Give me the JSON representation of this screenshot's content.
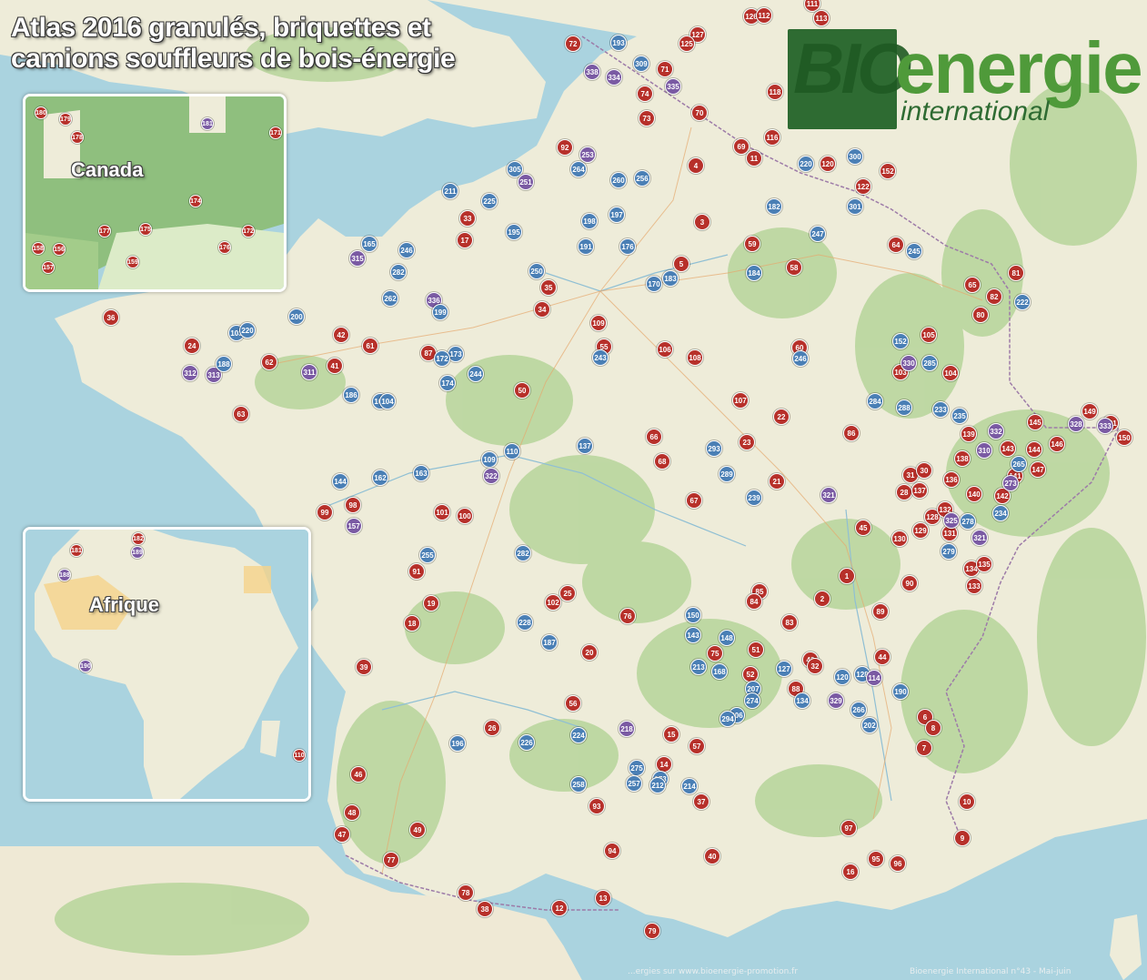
{
  "title": {
    "line1": "Atlas 2016 granulés, briquettes et",
    "line2": "camions souffleurs de bois-énergie"
  },
  "logo": {
    "bio": "BIO",
    "energie": "energie",
    "international": "international"
  },
  "insets": {
    "canada": {
      "label": "Canada"
    },
    "africa": {
      "label": "Afrique"
    }
  },
  "attribution": {
    "left": "...ergies sur www.bioenergie-promotion.fr",
    "right": "Bioenergie International n°43 - Mai-juin"
  },
  "colors": {
    "water": "#aad3df",
    "land": "#eeecd9",
    "forest": "#b6d59a",
    "granule_marker": "#b7302a",
    "truck_marker": "#4a7fb5",
    "briquette_marker": "#7a5aa3"
  },
  "markers": [
    {
      "label": "72",
      "type": "granule"
    },
    {
      "label": "126",
      "type": "granule"
    },
    {
      "label": "112",
      "type": "granule"
    },
    {
      "label": "111",
      "type": "granule"
    },
    {
      "label": "113",
      "type": "granule"
    },
    {
      "label": "127",
      "type": "granule"
    },
    {
      "label": "125",
      "type": "granule"
    },
    {
      "label": "71",
      "type": "granule"
    },
    {
      "label": "74",
      "type": "granule"
    },
    {
      "label": "73",
      "type": "granule"
    },
    {
      "label": "70",
      "type": "granule"
    },
    {
      "label": "118",
      "type": "granule"
    },
    {
      "label": "116",
      "type": "granule"
    },
    {
      "label": "69",
      "type": "granule"
    },
    {
      "label": "11",
      "type": "granule"
    },
    {
      "label": "120",
      "type": "granule"
    },
    {
      "label": "152",
      "type": "granule"
    },
    {
      "label": "122",
      "type": "granule"
    },
    {
      "label": "92",
      "type": "granule"
    },
    {
      "label": "4",
      "type": "granule"
    },
    {
      "label": "3",
      "type": "granule"
    },
    {
      "label": "33",
      "type": "granule"
    },
    {
      "label": "17",
      "type": "granule"
    },
    {
      "label": "59",
      "type": "granule"
    },
    {
      "label": "64",
      "type": "granule"
    },
    {
      "label": "81",
      "type": "granule"
    },
    {
      "label": "5",
      "type": "granule"
    },
    {
      "label": "58",
      "type": "granule"
    },
    {
      "label": "35",
      "type": "granule"
    },
    {
      "label": "34",
      "type": "granule"
    },
    {
      "label": "65",
      "type": "granule"
    },
    {
      "label": "82",
      "type": "granule"
    },
    {
      "label": "80",
      "type": "granule"
    },
    {
      "label": "36",
      "type": "granule"
    },
    {
      "label": "24",
      "type": "granule"
    },
    {
      "label": "42",
      "type": "granule"
    },
    {
      "label": "61",
      "type": "granule"
    },
    {
      "label": "62",
      "type": "granule"
    },
    {
      "label": "41",
      "type": "granule"
    },
    {
      "label": "87",
      "type": "granule"
    },
    {
      "label": "109",
      "type": "granule"
    },
    {
      "label": "55",
      "type": "granule"
    },
    {
      "label": "106",
      "type": "granule"
    },
    {
      "label": "108",
      "type": "granule"
    },
    {
      "label": "60",
      "type": "granule"
    },
    {
      "label": "105",
      "type": "granule"
    },
    {
      "label": "103",
      "type": "granule"
    },
    {
      "label": "104",
      "type": "granule"
    },
    {
      "label": "63",
      "type": "granule"
    },
    {
      "label": "50",
      "type": "granule"
    },
    {
      "label": "107",
      "type": "granule"
    },
    {
      "label": "22",
      "type": "granule"
    },
    {
      "label": "86",
      "type": "granule"
    },
    {
      "label": "139",
      "type": "granule"
    },
    {
      "label": "145",
      "type": "granule"
    },
    {
      "label": "149",
      "type": "granule"
    },
    {
      "label": "151",
      "type": "granule"
    },
    {
      "label": "150",
      "type": "granule"
    },
    {
      "label": "66",
      "type": "granule"
    },
    {
      "label": "68",
      "type": "granule"
    },
    {
      "label": "23",
      "type": "granule"
    },
    {
      "label": "143",
      "type": "granule"
    },
    {
      "label": "144",
      "type": "granule"
    },
    {
      "label": "146",
      "type": "granule"
    },
    {
      "label": "138",
      "type": "granule"
    },
    {
      "label": "147",
      "type": "granule"
    },
    {
      "label": "141",
      "type": "granule"
    },
    {
      "label": "21",
      "type": "granule"
    },
    {
      "label": "31",
      "type": "granule"
    },
    {
      "label": "30",
      "type": "granule"
    },
    {
      "label": "136",
      "type": "granule"
    },
    {
      "label": "28",
      "type": "granule"
    },
    {
      "label": "137",
      "type": "granule"
    },
    {
      "label": "140",
      "type": "granule"
    },
    {
      "label": "142",
      "type": "granule"
    },
    {
      "label": "99",
      "type": "granule"
    },
    {
      "label": "98",
      "type": "granule"
    },
    {
      "label": "101",
      "type": "granule"
    },
    {
      "label": "100",
      "type": "granule"
    },
    {
      "label": "67",
      "type": "granule"
    },
    {
      "label": "45",
      "type": "granule"
    },
    {
      "label": "128",
      "type": "granule"
    },
    {
      "label": "129",
      "type": "granule"
    },
    {
      "label": "131",
      "type": "granule"
    },
    {
      "label": "130",
      "type": "granule"
    },
    {
      "label": "132",
      "type": "granule"
    },
    {
      "label": "91",
      "type": "granule"
    },
    {
      "label": "19",
      "type": "granule"
    },
    {
      "label": "18",
      "type": "granule"
    },
    {
      "label": "25",
      "type": "granule"
    },
    {
      "label": "102",
      "type": "granule"
    },
    {
      "label": "76",
      "type": "granule"
    },
    {
      "label": "1",
      "type": "granule"
    },
    {
      "label": "2",
      "type": "granule"
    },
    {
      "label": "90",
      "type": "granule"
    },
    {
      "label": "134",
      "type": "granule"
    },
    {
      "label": "135",
      "type": "granule"
    },
    {
      "label": "133",
      "type": "granule"
    },
    {
      "label": "85",
      "type": "granule"
    },
    {
      "label": "84",
      "type": "granule"
    },
    {
      "label": "83",
      "type": "granule"
    },
    {
      "label": "89",
      "type": "granule"
    },
    {
      "label": "39",
      "type": "granule"
    },
    {
      "label": "20",
      "type": "granule"
    },
    {
      "label": "75",
      "type": "granule"
    },
    {
      "label": "51",
      "type": "granule"
    },
    {
      "label": "52",
      "type": "granule"
    },
    {
      "label": "43",
      "type": "granule"
    },
    {
      "label": "32",
      "type": "granule"
    },
    {
      "label": "44",
      "type": "granule"
    },
    {
      "label": "88",
      "type": "granule"
    },
    {
      "label": "56",
      "type": "granule"
    },
    {
      "label": "26",
      "type": "granule"
    },
    {
      "label": "15",
      "type": "granule"
    },
    {
      "label": "57",
      "type": "granule"
    },
    {
      "label": "6",
      "type": "granule"
    },
    {
      "label": "8",
      "type": "granule"
    },
    {
      "label": "7",
      "type": "granule"
    },
    {
      "label": "46",
      "type": "granule"
    },
    {
      "label": "14",
      "type": "granule"
    },
    {
      "label": "37",
      "type": "granule"
    },
    {
      "label": "10",
      "type": "granule"
    },
    {
      "label": "48",
      "type": "granule"
    },
    {
      "label": "47",
      "type": "granule"
    },
    {
      "label": "49",
      "type": "granule"
    },
    {
      "label": "93",
      "type": "granule"
    },
    {
      "label": "97",
      "type": "granule"
    },
    {
      "label": "9",
      "type": "granule"
    },
    {
      "label": "77",
      "type": "granule"
    },
    {
      "label": "94",
      "type": "granule"
    },
    {
      "label": "40",
      "type": "granule"
    },
    {
      "label": "95",
      "type": "granule"
    },
    {
      "label": "96",
      "type": "granule"
    },
    {
      "label": "16",
      "type": "granule"
    },
    {
      "label": "78",
      "type": "granule"
    },
    {
      "label": "38",
      "type": "granule"
    },
    {
      "label": "12",
      "type": "granule"
    },
    {
      "label": "13",
      "type": "granule"
    },
    {
      "label": "79",
      "type": "granule"
    },
    {
      "label": "193",
      "type": "truck"
    },
    {
      "label": "309",
      "type": "truck"
    },
    {
      "label": "334",
      "type": "briquette"
    },
    {
      "label": "335",
      "type": "briquette"
    },
    {
      "label": "338",
      "type": "briquette"
    },
    {
      "label": "220",
      "type": "truck"
    },
    {
      "label": "300",
      "type": "truck"
    },
    {
      "label": "301",
      "type": "truck"
    },
    {
      "label": "305",
      "type": "truck"
    },
    {
      "label": "264",
      "type": "truck"
    },
    {
      "label": "253",
      "type": "briquette"
    },
    {
      "label": "260",
      "type": "truck"
    },
    {
      "label": "256",
      "type": "truck"
    },
    {
      "label": "251",
      "type": "briquette"
    },
    {
      "label": "211",
      "type": "truck"
    },
    {
      "label": "225",
      "type": "truck"
    },
    {
      "label": "195",
      "type": "truck"
    },
    {
      "label": "198",
      "type": "truck"
    },
    {
      "label": "197",
      "type": "truck"
    },
    {
      "label": "191",
      "type": "truck"
    },
    {
      "label": "176",
      "type": "truck"
    },
    {
      "label": "182",
      "type": "truck"
    },
    {
      "label": "247",
      "type": "truck"
    },
    {
      "label": "245",
      "type": "truck"
    },
    {
      "label": "165",
      "type": "truck"
    },
    {
      "label": "246",
      "type": "truck"
    },
    {
      "label": "315",
      "type": "briquette"
    },
    {
      "label": "282",
      "type": "truck"
    },
    {
      "label": "262",
      "type": "truck"
    },
    {
      "label": "250",
      "type": "truck"
    },
    {
      "label": "170",
      "type": "truck"
    },
    {
      "label": "183",
      "type": "truck"
    },
    {
      "label": "184",
      "type": "truck"
    },
    {
      "label": "222",
      "type": "truck"
    },
    {
      "label": "336",
      "type": "briquette"
    },
    {
      "label": "199",
      "type": "truck"
    },
    {
      "label": "200",
      "type": "truck"
    },
    {
      "label": "103",
      "type": "truck"
    },
    {
      "label": "220",
      "type": "truck"
    },
    {
      "label": "312",
      "type": "briquette"
    },
    {
      "label": "313",
      "type": "briquette"
    },
    {
      "label": "188",
      "type": "truck"
    },
    {
      "label": "311",
      "type": "briquette"
    },
    {
      "label": "186",
      "type": "truck"
    },
    {
      "label": "105",
      "type": "truck"
    },
    {
      "label": "104",
      "type": "truck"
    },
    {
      "label": "173",
      "type": "truck"
    },
    {
      "label": "172",
      "type": "truck"
    },
    {
      "label": "174",
      "type": "truck"
    },
    {
      "label": "244",
      "type": "truck"
    },
    {
      "label": "243",
      "type": "truck"
    },
    {
      "label": "246",
      "type": "truck"
    },
    {
      "label": "152",
      "type": "truck"
    },
    {
      "label": "330",
      "type": "briquette"
    },
    {
      "label": "285",
      "type": "truck"
    },
    {
      "label": "284",
      "type": "truck"
    },
    {
      "label": "233",
      "type": "truck"
    },
    {
      "label": "288",
      "type": "truck"
    },
    {
      "label": "235",
      "type": "truck"
    },
    {
      "label": "332",
      "type": "briquette"
    },
    {
      "label": "328",
      "type": "briquette"
    },
    {
      "label": "333",
      "type": "briquette"
    },
    {
      "label": "162",
      "type": "truck"
    },
    {
      "label": "163",
      "type": "truck"
    },
    {
      "label": "144",
      "type": "truck"
    },
    {
      "label": "157",
      "type": "briquette"
    },
    {
      "label": "110",
      "type": "truck"
    },
    {
      "label": "109",
      "type": "truck"
    },
    {
      "label": "322",
      "type": "briquette"
    },
    {
      "label": "137",
      "type": "truck"
    },
    {
      "label": "293",
      "type": "truck"
    },
    {
      "label": "289",
      "type": "truck"
    },
    {
      "label": "239",
      "type": "truck"
    },
    {
      "label": "321",
      "type": "briquette"
    },
    {
      "label": "325",
      "type": "briquette"
    },
    {
      "label": "279",
      "type": "truck"
    },
    {
      "label": "278",
      "type": "truck"
    },
    {
      "label": "321",
      "type": "briquette"
    },
    {
      "label": "265",
      "type": "truck"
    },
    {
      "label": "310",
      "type": "briquette"
    },
    {
      "label": "273",
      "type": "briquette"
    },
    {
      "label": "234",
      "type": "truck"
    },
    {
      "label": "255",
      "type": "truck"
    },
    {
      "label": "282",
      "type": "truck"
    },
    {
      "label": "228",
      "type": "truck"
    },
    {
      "label": "187",
      "type": "truck"
    },
    {
      "label": "150",
      "type": "truck"
    },
    {
      "label": "143",
      "type": "truck"
    },
    {
      "label": "148",
      "type": "truck"
    },
    {
      "label": "168",
      "type": "truck"
    },
    {
      "label": "127",
      "type": "truck"
    },
    {
      "label": "120",
      "type": "truck"
    },
    {
      "label": "128",
      "type": "truck"
    },
    {
      "label": "114",
      "type": "briquette"
    },
    {
      "label": "190",
      "type": "truck"
    },
    {
      "label": "202",
      "type": "truck"
    },
    {
      "label": "266",
      "type": "truck"
    },
    {
      "label": "329",
      "type": "briquette"
    },
    {
      "label": "134",
      "type": "truck"
    },
    {
      "label": "213",
      "type": "truck"
    },
    {
      "label": "207",
      "type": "truck"
    },
    {
      "label": "206",
      "type": "truck"
    },
    {
      "label": "196",
      "type": "truck"
    },
    {
      "label": "226",
      "type": "truck"
    },
    {
      "label": "224",
      "type": "truck"
    },
    {
      "label": "218",
      "type": "briquette"
    },
    {
      "label": "294",
      "type": "truck"
    },
    {
      "label": "274",
      "type": "truck"
    },
    {
      "label": "275",
      "type": "truck"
    },
    {
      "label": "273",
      "type": "truck"
    },
    {
      "label": "212",
      "type": "truck"
    },
    {
      "label": "214",
      "type": "truck"
    },
    {
      "label": "257",
      "type": "truck"
    },
    {
      "label": "258",
      "type": "truck"
    }
  ],
  "canada_markers": [
    {
      "label": "180",
      "type": "granule"
    },
    {
      "label": "179",
      "type": "granule"
    },
    {
      "label": "178",
      "type": "granule"
    },
    {
      "label": "171",
      "type": "granule"
    },
    {
      "label": "174",
      "type": "granule"
    },
    {
      "label": "177",
      "type": "granule"
    },
    {
      "label": "175",
      "type": "granule"
    },
    {
      "label": "172",
      "type": "granule"
    },
    {
      "label": "176",
      "type": "granule"
    },
    {
      "label": "158",
      "type": "granule"
    },
    {
      "label": "156",
      "type": "granule"
    },
    {
      "label": "157",
      "type": "granule"
    },
    {
      "label": "159",
      "type": "granule"
    },
    {
      "label": "181",
      "type": "briquette"
    }
  ],
  "africa_markers": [
    {
      "label": "181",
      "type": "granule"
    },
    {
      "label": "182",
      "type": "granule"
    },
    {
      "label": "189",
      "type": "briquette"
    },
    {
      "label": "188",
      "type": "briquette"
    },
    {
      "label": "190",
      "type": "briquette"
    },
    {
      "label": "110",
      "type": "granule"
    }
  ]
}
